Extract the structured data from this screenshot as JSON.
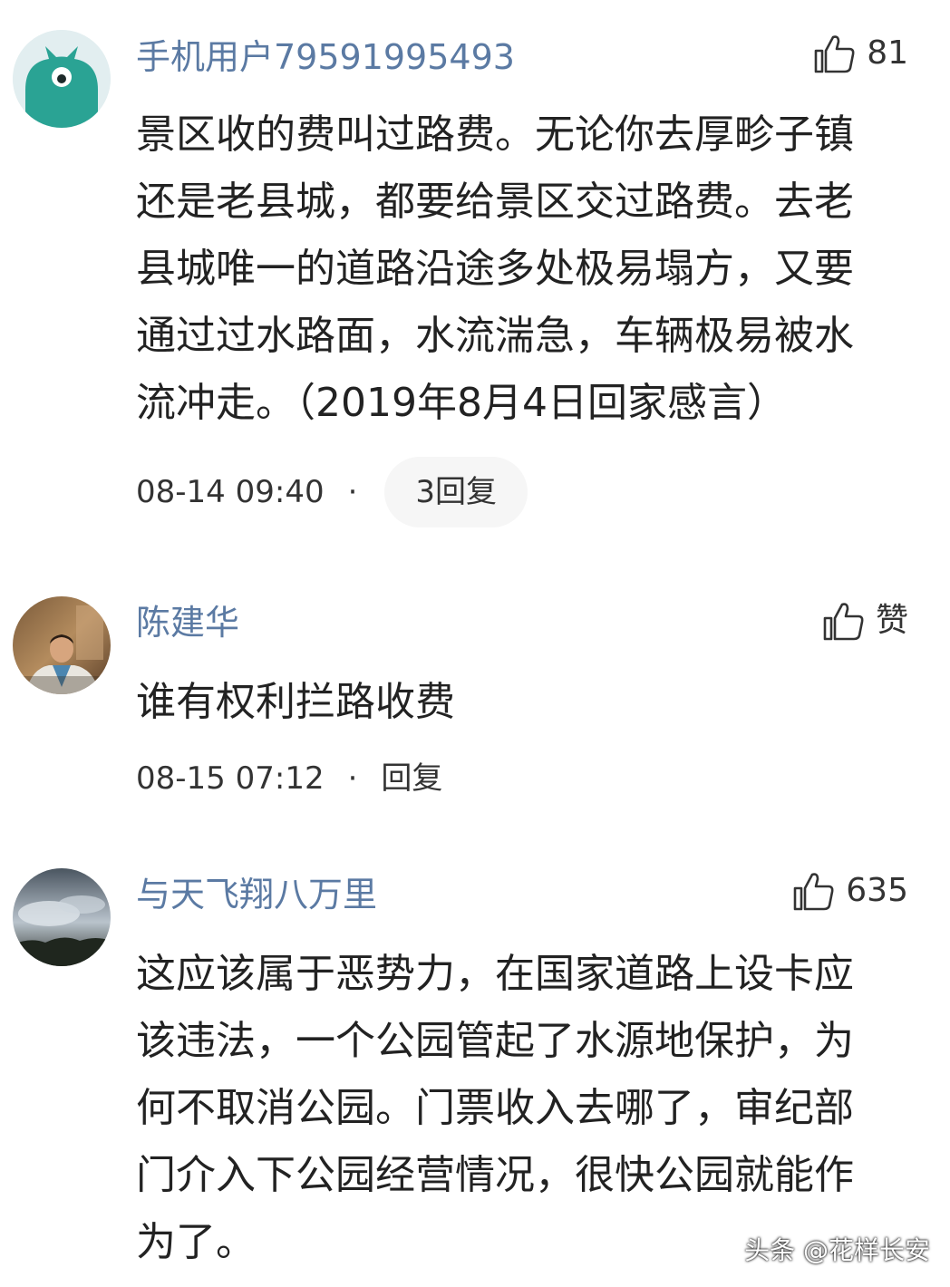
{
  "comments": [
    {
      "username": "手机用户79591995493",
      "likes": "81",
      "lines": [
        "景区收的费叫过路费。无论你去厚畛子镇",
        "还是老县城，都要给景区交过路费。去老",
        "县城唯一的道路沿途多处极易塌方，又要",
        "通过过水路面，水流湍急，车辆极易被水",
        "流冲走。（2019年8月4日回家感言）"
      ],
      "time": "08-14 09:40",
      "separator": "·",
      "reply_label": "3回复"
    },
    {
      "username": "陈建华",
      "likes": "赞",
      "lines": [
        "谁有权利拦路收费"
      ],
      "time": "08-15 07:12",
      "separator": "·",
      "reply_label": "回复"
    },
    {
      "username": "与天飞翔八万里",
      "likes": "635",
      "lines": [
        "这应该属于恶势力，在国家道路上设卡应",
        "该违法，一个公园管起了水源地保护，为",
        "何不取消公园。门票收入去哪了，审纪部",
        "门介入下公园经营情况，很快公园就能作",
        "为了。"
      ]
    }
  ],
  "watermark": "头条 @花样长安",
  "icons": {
    "like": "thumbs-up-icon",
    "avatar1": "green-monster-avatar",
    "avatar2": "man-photo-avatar",
    "avatar3": "sky-photo-avatar"
  },
  "colors": {
    "username": "#5b7aa3",
    "text": "#222222",
    "avatar1_bg": "#e2eef0",
    "avatar1_monster": "#2aa394"
  }
}
